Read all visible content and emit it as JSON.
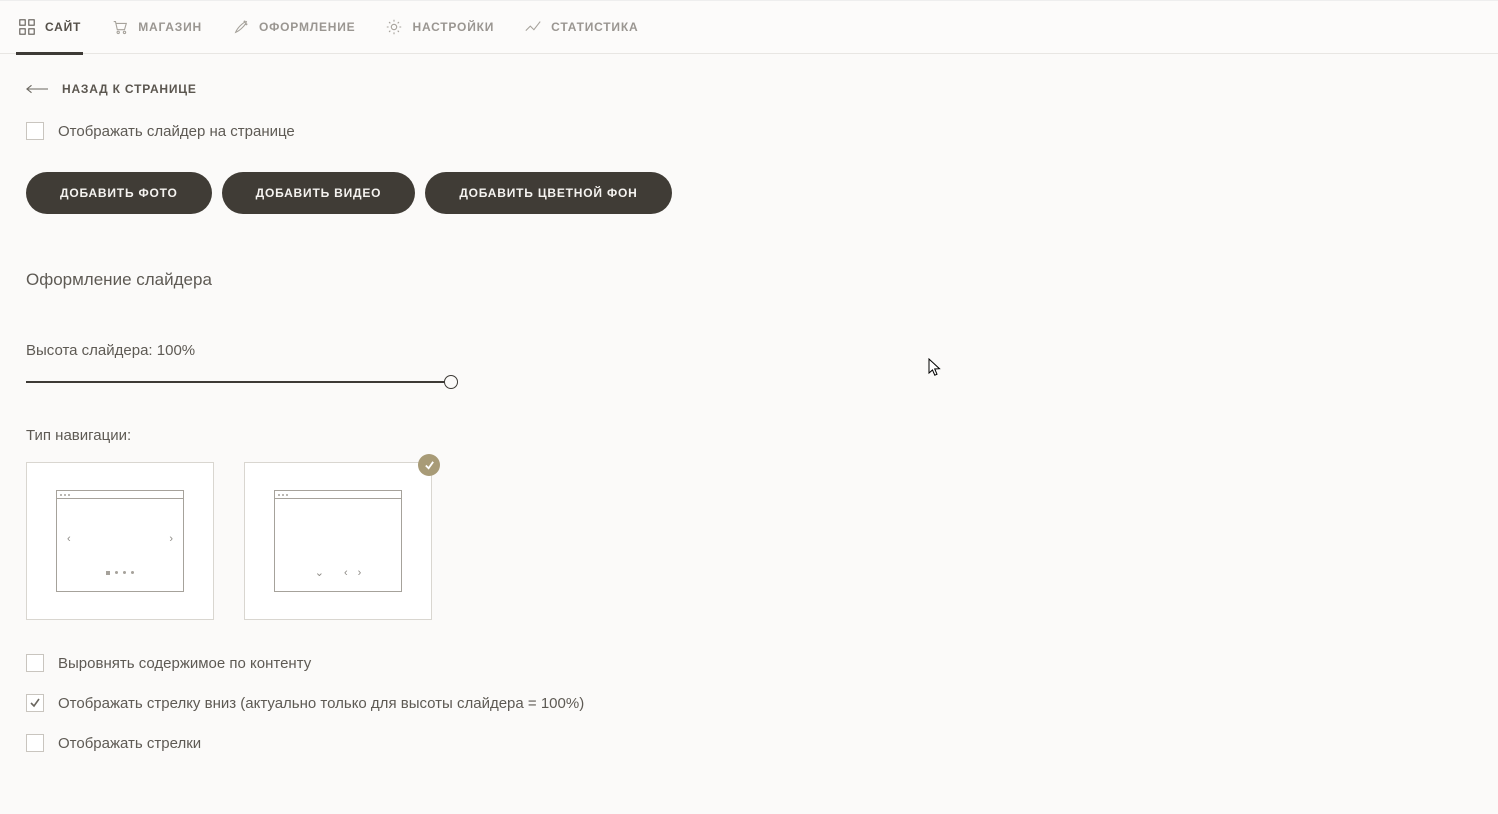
{
  "tabs": {
    "site": "САЙТ",
    "store": "МАГАЗИН",
    "design": "ОФОРМЛЕНИЕ",
    "settings": "НАСТРОЙКИ",
    "stats": "СТАТИСТИКА"
  },
  "back_label": "НАЗАД К СТРАНИЦЕ",
  "show_slider_label": "Отображать слайдер на странице",
  "buttons": {
    "add_photo": "ДОБАВИТЬ ФОТО",
    "add_video": "ДОБАВИТЬ ВИДЕО",
    "add_bg": "ДОБАВИТЬ ЦВЕТНОЙ ФОН"
  },
  "section_title": "Оформление слайдера",
  "slider_height_label": "Высота слайдера: 100%",
  "nav_type_label": "Тип навигации:",
  "opts": {
    "align": "Выровнять содержимое по контенту",
    "arrow_down": "Отображать стрелку вниз (актуально только для высоты слайдера = 100%)",
    "arrows": "Отображать стрелки"
  }
}
